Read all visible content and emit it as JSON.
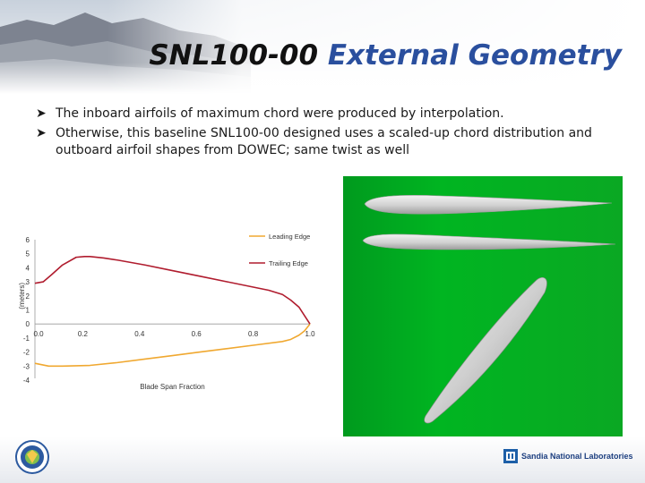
{
  "slide": {
    "title_part1": "SNL100-00",
    "title_part2": "External Geometry",
    "bullets": [
      "The inboard airfoils of maximum chord were produced by interpolation.",
      "Otherwise, this baseline SNL100-00 designed uses a scaled-up chord distribution and outboard airfoil shapes from DOWEC; same twist as well"
    ],
    "bullet_icon": "arrow-bullet-icon",
    "logos": {
      "left": "doe-seal-icon",
      "right_text": "Sandia National Laboratories"
    },
    "colors": {
      "title_accent": "#2a4f9e",
      "leading_edge": "#f0a830",
      "trailing_edge": "#b01c2e",
      "render_background": "#00a820",
      "blade": "#d4d4d4"
    }
  },
  "chart_data": {
    "type": "line",
    "title": "",
    "xlabel": "Blade Span Fraction",
    "ylabel": "(meters)",
    "xlim": [
      0,
      1.0
    ],
    "ylim": [
      -4,
      6
    ],
    "x_ticks": [
      "0.0",
      "0.2",
      "0.4",
      "0.6",
      "0.8",
      "1.0"
    ],
    "y_ticks": [
      "-4",
      "-3",
      "-2",
      "-1",
      "0",
      "1",
      "2",
      "3",
      "4",
      "5",
      "6"
    ],
    "grid": false,
    "legend_position": "top-right",
    "series": [
      {
        "name": "Leading Edge",
        "color": "#f0a830",
        "x": [
          0.0,
          0.05,
          0.1,
          0.2,
          0.3,
          0.4,
          0.5,
          0.6,
          0.7,
          0.8,
          0.9,
          0.93,
          0.96,
          0.98,
          1.0
        ],
        "y": [
          -2.8,
          -3.0,
          -3.0,
          -2.95,
          -2.75,
          -2.5,
          -2.25,
          -2.0,
          -1.75,
          -1.5,
          -1.25,
          -1.1,
          -0.8,
          -0.5,
          0.0
        ]
      },
      {
        "name": "Trailing Edge",
        "color": "#b01c2e",
        "x": [
          0.0,
          0.03,
          0.06,
          0.1,
          0.15,
          0.18,
          0.2,
          0.25,
          0.3,
          0.4,
          0.5,
          0.6,
          0.7,
          0.8,
          0.85,
          0.9,
          0.93,
          0.96,
          0.98,
          1.0
        ],
        "y": [
          2.9,
          3.0,
          3.5,
          4.2,
          4.75,
          4.8,
          4.8,
          4.7,
          4.55,
          4.2,
          3.8,
          3.4,
          3.0,
          2.6,
          2.4,
          2.1,
          1.7,
          1.2,
          0.6,
          0.0
        ]
      }
    ]
  }
}
